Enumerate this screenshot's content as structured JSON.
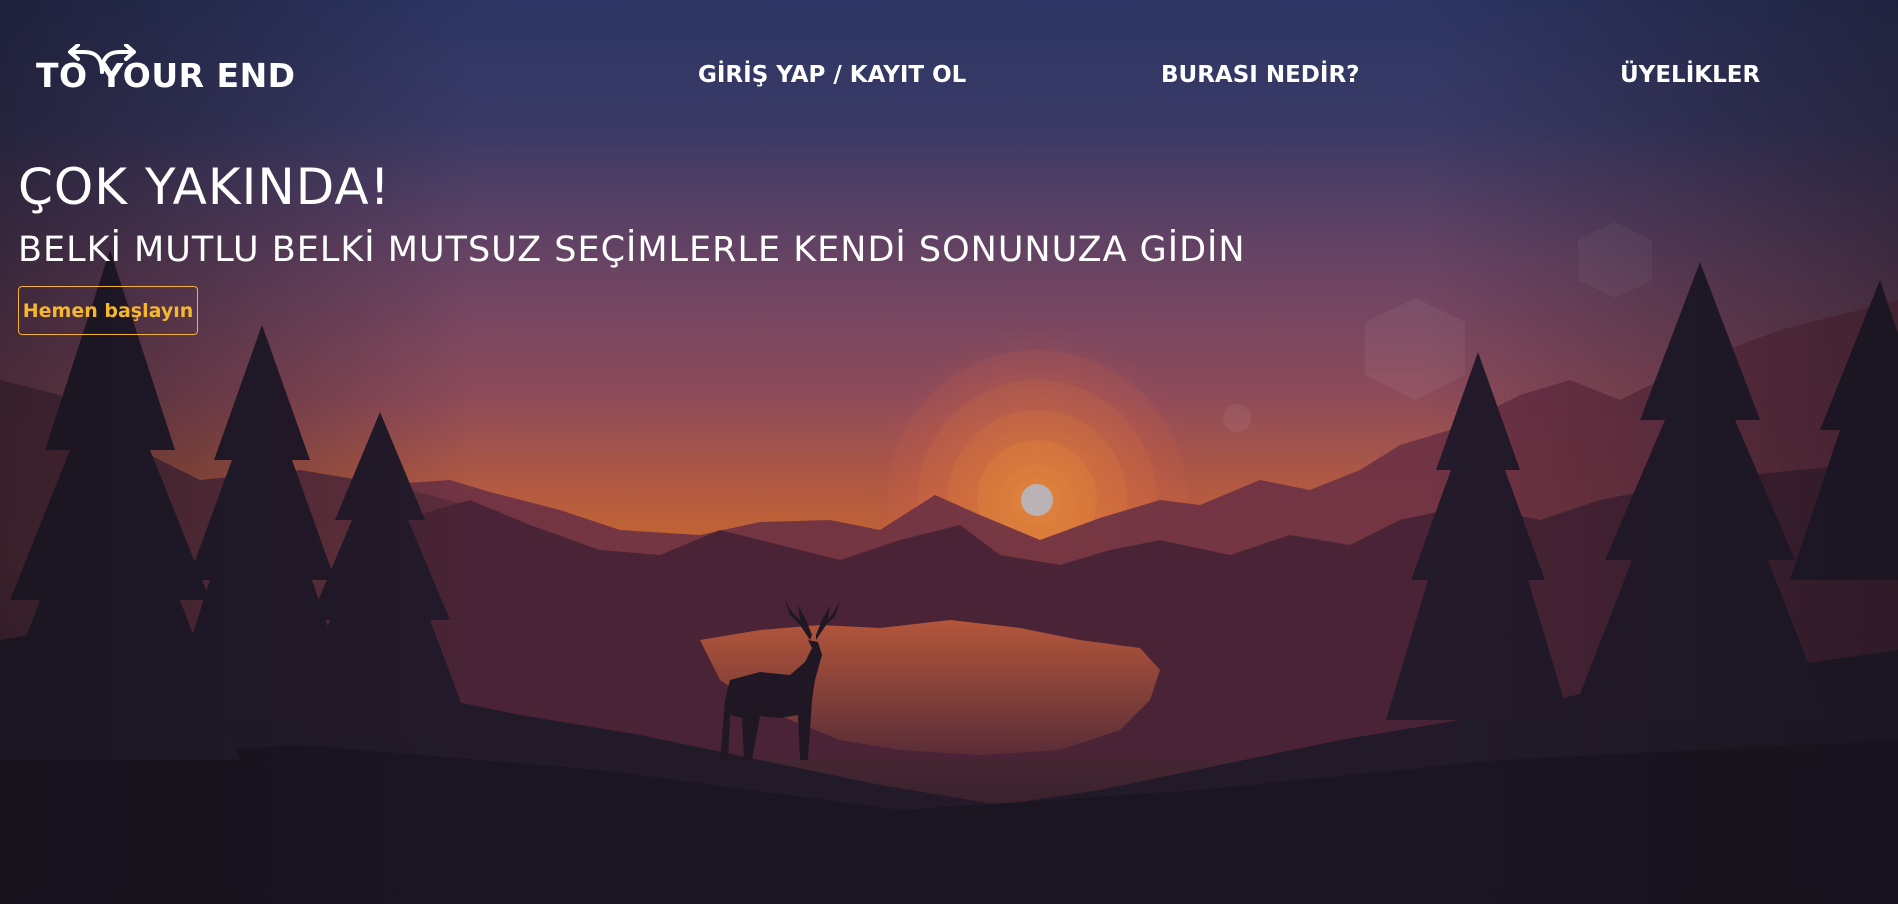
{
  "colors": {
    "accent": "#f5b72e",
    "text": "#ffffff",
    "sky_top": "#2b3560",
    "sky_mid": "#8a4a5e",
    "horizon": "#c9692e",
    "ground": "#1b1622"
  },
  "header": {
    "logo_text": "TO YOUR END",
    "logo_icon": "branching-arrows-icon",
    "nav": [
      {
        "label": "GİRİŞ YAP / KAYIT OL"
      },
      {
        "label": "BURASI NEDİR?"
      },
      {
        "label": "ÜYELİKLER"
      }
    ]
  },
  "hero": {
    "title": "ÇOK YAKINDA!",
    "subtitle": "BELKİ MUTLU BELKİ MUTSUZ SEÇİMLERLE KENDİ SONUNUZA GİDİN",
    "cta_label": "Hemen başlayın"
  }
}
